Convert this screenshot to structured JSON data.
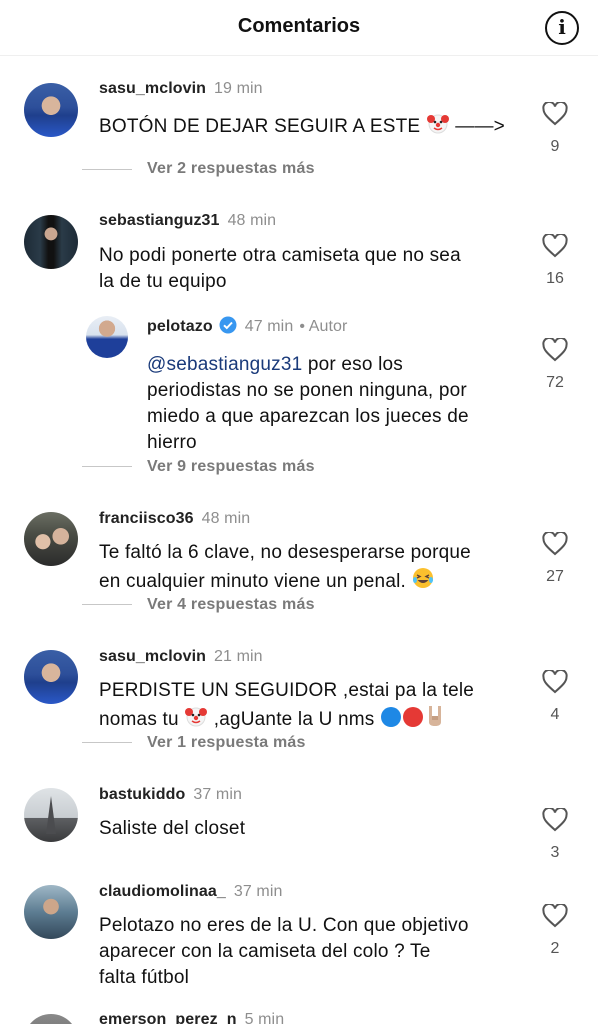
{
  "header": {
    "title": "Comentarios",
    "info_icon": "info-icon"
  },
  "colors": {
    "mention": "#1a3a7a",
    "muted": "#8e8e8e",
    "verified": "#3897f0",
    "text": "#111111"
  },
  "comments": [
    {
      "username": "sasu_mclovin",
      "time": "19 min",
      "text": "BOTÓN DE DEJAR SEGUIR A ESTE",
      "text_suffix": " ——>",
      "emoji": [
        "clown"
      ],
      "likes": "9",
      "replies": "Ver 2 respuestas más"
    },
    {
      "username": "sebastianguz31",
      "time": "48 min",
      "line1": "No podi ponerte otra camiseta que no sea",
      "line2": "la de tu equipo",
      "likes": "16"
    },
    {
      "username": "pelotazo",
      "verified": true,
      "time": "47 min",
      "author_label": "• Autor",
      "mention": "@sebastianguz31",
      "line1": " por eso los",
      "line2": "periodistas no se ponen ninguna, por",
      "line3": "miedo a que aparezcan los jueces de",
      "line4": "hierro",
      "likes": "72",
      "replies": "Ver 9 respuestas más"
    },
    {
      "username": "franciisco36",
      "time": "48 min",
      "line1": "Te faltó la 6 clave, no desesperarse porque",
      "line2": "en cualquier minuto viene un penal.",
      "emoji": [
        "laughing"
      ],
      "likes": "27",
      "replies": "Ver 4 respuestas más"
    },
    {
      "username": "sasu_mclovin",
      "time": "21 min",
      "line1": "PERDISTE UN SEGUIDOR ,estai pa la tele",
      "line2a": "nomas tu",
      "line2b": " ,agUante la U nms",
      "emoji": [
        "clown",
        "blue-circle",
        "red-circle",
        "rock-on"
      ],
      "likes": "4",
      "replies": "Ver 1 respuesta más"
    },
    {
      "username": "bastukiddo",
      "time": "37 min",
      "line1": "Saliste del closet",
      "likes": "3"
    },
    {
      "username": "claudiomolinaa_",
      "time": "37 min",
      "line1": "Pelotazo no eres de la U. Con que objetivo",
      "line2": "aparecer con la camiseta del colo ? Te",
      "line3": "falta fútbol",
      "likes": "2"
    },
    {
      "username": "emerson_perez_n",
      "time": "5 min"
    }
  ]
}
